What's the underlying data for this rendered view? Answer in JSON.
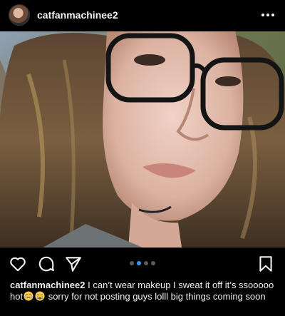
{
  "header": {
    "username": "catfanmachinee2",
    "more_icon": "more-horizontal-icon"
  },
  "photo": {
    "description_icon": "selfie-photo"
  },
  "actions": {
    "like_icon": "heart-icon",
    "comment_icon": "comment-icon",
    "share_icon": "send-icon",
    "save_icon": "bookmark-icon"
  },
  "carousel": {
    "total": 4,
    "active_index": 1,
    "active_color": "#3897f0",
    "inactive_color": "#5a5a5a"
  },
  "caption": {
    "username": "catfanmachinee2",
    "text_part1": " I can’t wear makeup I sweat it off it’s ssooooo hot",
    "text_part2": " sorry for not posting guys lolll big things coming soon",
    "emojis": [
      "sweat-crying-face-emoji",
      "crying-face-emoji"
    ]
  }
}
